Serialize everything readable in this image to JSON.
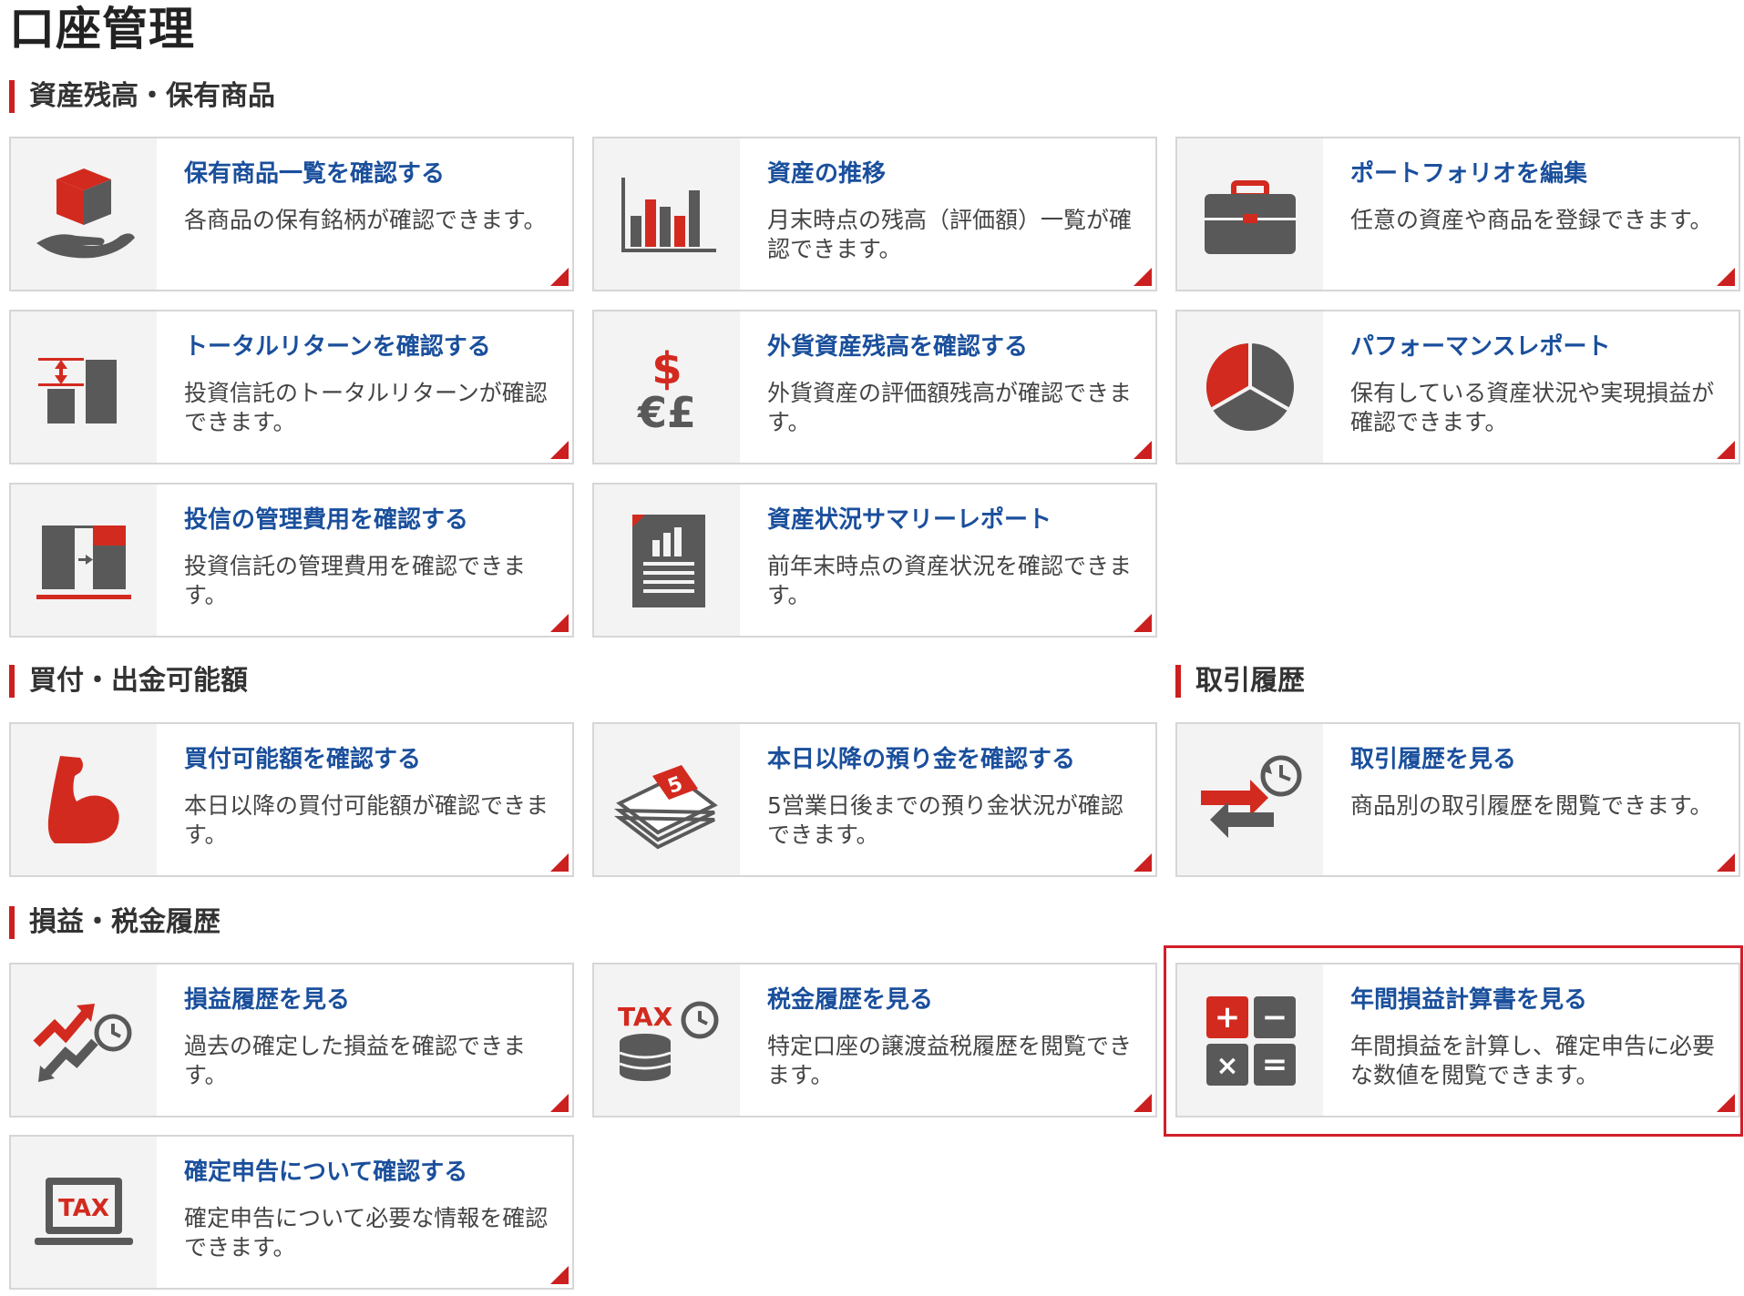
{
  "page_title": "口座管理",
  "sections": {
    "assets": "資産残高・保有商品",
    "buying_power": "買付・出金可能額",
    "trade_history": "取引履歴",
    "pnl_tax": "損益・税金履歴"
  },
  "cards": {
    "holdings": {
      "title": "保有商品一覧を確認する",
      "desc": "各商品の保有銘柄が確認できます。",
      "icon": "box-on-hand-icon"
    },
    "asset_trend": {
      "title": "資産の推移",
      "desc": "月末時点の残高（評価額）一覧が確認できます。",
      "icon": "bar-chart-icon"
    },
    "portfolio": {
      "title": "ポートフォリオを編集",
      "desc": "任意の資産や商品を登録できます。",
      "icon": "briefcase-icon"
    },
    "total_return": {
      "title": "トータルリターンを確認する",
      "desc": "投資信託のトータルリターンが確認できます。",
      "icon": "return-bars-icon"
    },
    "foreign_currency": {
      "title": "外貨資産残高を確認する",
      "desc": "外貨資産の評価額残高が確認できます。",
      "icon": "currency-icon"
    },
    "performance": {
      "title": "パフォーマンスレポート",
      "desc": "保有している資産状況や実現損益が確認できます。",
      "icon": "pie-chart-icon"
    },
    "fund_cost": {
      "title": "投信の管理費用を確認する",
      "desc": "投資信託の管理費用を確認できます。",
      "icon": "cost-bars-icon"
    },
    "summary_report": {
      "title": "資産状況サマリーレポート",
      "desc": "前年末時点の資産状況を確認できます。",
      "icon": "report-document-icon"
    },
    "buying_capacity": {
      "title": "買付可能額を確認する",
      "desc": "本日以降の買付可能額が確認できます。",
      "icon": "muscle-arm-icon"
    },
    "deposit": {
      "title": "本日以降の預り金を確認する",
      "desc": "5営業日後までの預り金状況が確認できます。",
      "icon": "cash-stack-icon"
    },
    "trades": {
      "title": "取引履歴を見る",
      "desc": "商品別の取引履歴を閲覧できます。",
      "icon": "exchange-clock-icon"
    },
    "pnl_history": {
      "title": "損益履歴を見る",
      "desc": "過去の確定した損益を確認できます。",
      "icon": "trend-clock-icon"
    },
    "tax_history": {
      "title": "税金履歴を見る",
      "desc": "特定口座の譲渡益税履歴を閲覧できます。",
      "icon": "tax-coins-icon"
    },
    "annual_pnl": {
      "title": "年間損益計算書を見る",
      "desc": "年間損益を計算し、確定申告に必要な数値を閲覧できます。",
      "icon": "calculator-icon"
    },
    "tax_return": {
      "title": "確定申告について確認する",
      "desc": "確定申告について必要な情報を確認できます。",
      "icon": "tax-laptop-icon"
    }
  },
  "icon_glyphs": {
    "dollar": "$",
    "euro_pound": "€£",
    "day_number": "5",
    "tax_label": "TAX",
    "calc_plus": "+",
    "calc_minus": "−",
    "calc_times": "×",
    "calc_equals": "="
  },
  "colors": {
    "accent_red": "#d32a1f",
    "icon_gray": "#595959",
    "link_blue": "#1a4f9c",
    "highlight": "#d21e2a"
  }
}
